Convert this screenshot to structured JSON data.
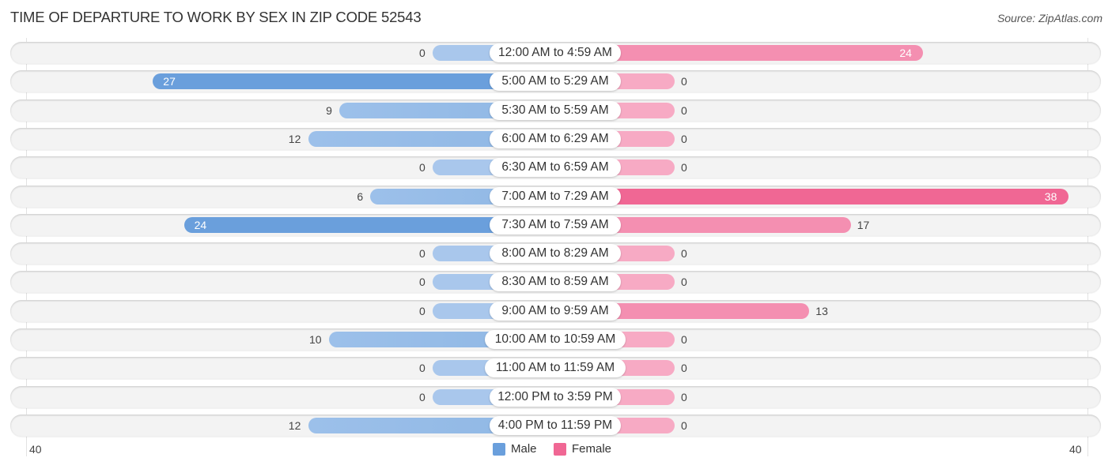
{
  "title": "TIME OF DEPARTURE TO WORK BY SEX IN ZIP CODE 52543",
  "source": "Source: ZipAtlas.com",
  "colors": {
    "male": "#6a9fdc",
    "female": "#f06794"
  },
  "chart_data": {
    "type": "bar",
    "orientation": "horizontal-diverging",
    "title": "TIME OF DEPARTURE TO WORK BY SEX IN ZIP CODE 52543",
    "categories": [
      "12:00 AM to 4:59 AM",
      "5:00 AM to 5:29 AM",
      "5:30 AM to 5:59 AM",
      "6:00 AM to 6:29 AM",
      "6:30 AM to 6:59 AM",
      "7:00 AM to 7:29 AM",
      "7:30 AM to 7:59 AM",
      "8:00 AM to 8:29 AM",
      "8:30 AM to 8:59 AM",
      "9:00 AM to 9:59 AM",
      "10:00 AM to 10:59 AM",
      "11:00 AM to 11:59 AM",
      "12:00 PM to 3:59 PM",
      "4:00 PM to 11:59 PM"
    ],
    "series": [
      {
        "name": "Male",
        "values": [
          0,
          27,
          9,
          12,
          0,
          6,
          24,
          0,
          0,
          0,
          10,
          0,
          0,
          12
        ]
      },
      {
        "name": "Female",
        "values": [
          24,
          0,
          0,
          0,
          0,
          38,
          17,
          0,
          0,
          13,
          0,
          0,
          0,
          0
        ]
      }
    ],
    "axis_ticks": {
      "left": "40",
      "right": "40"
    },
    "xlim": [
      -40,
      40
    ],
    "legend": {
      "position": "bottom-center",
      "entries": [
        "Male",
        "Female"
      ]
    },
    "xlabel": "",
    "ylabel": ""
  }
}
